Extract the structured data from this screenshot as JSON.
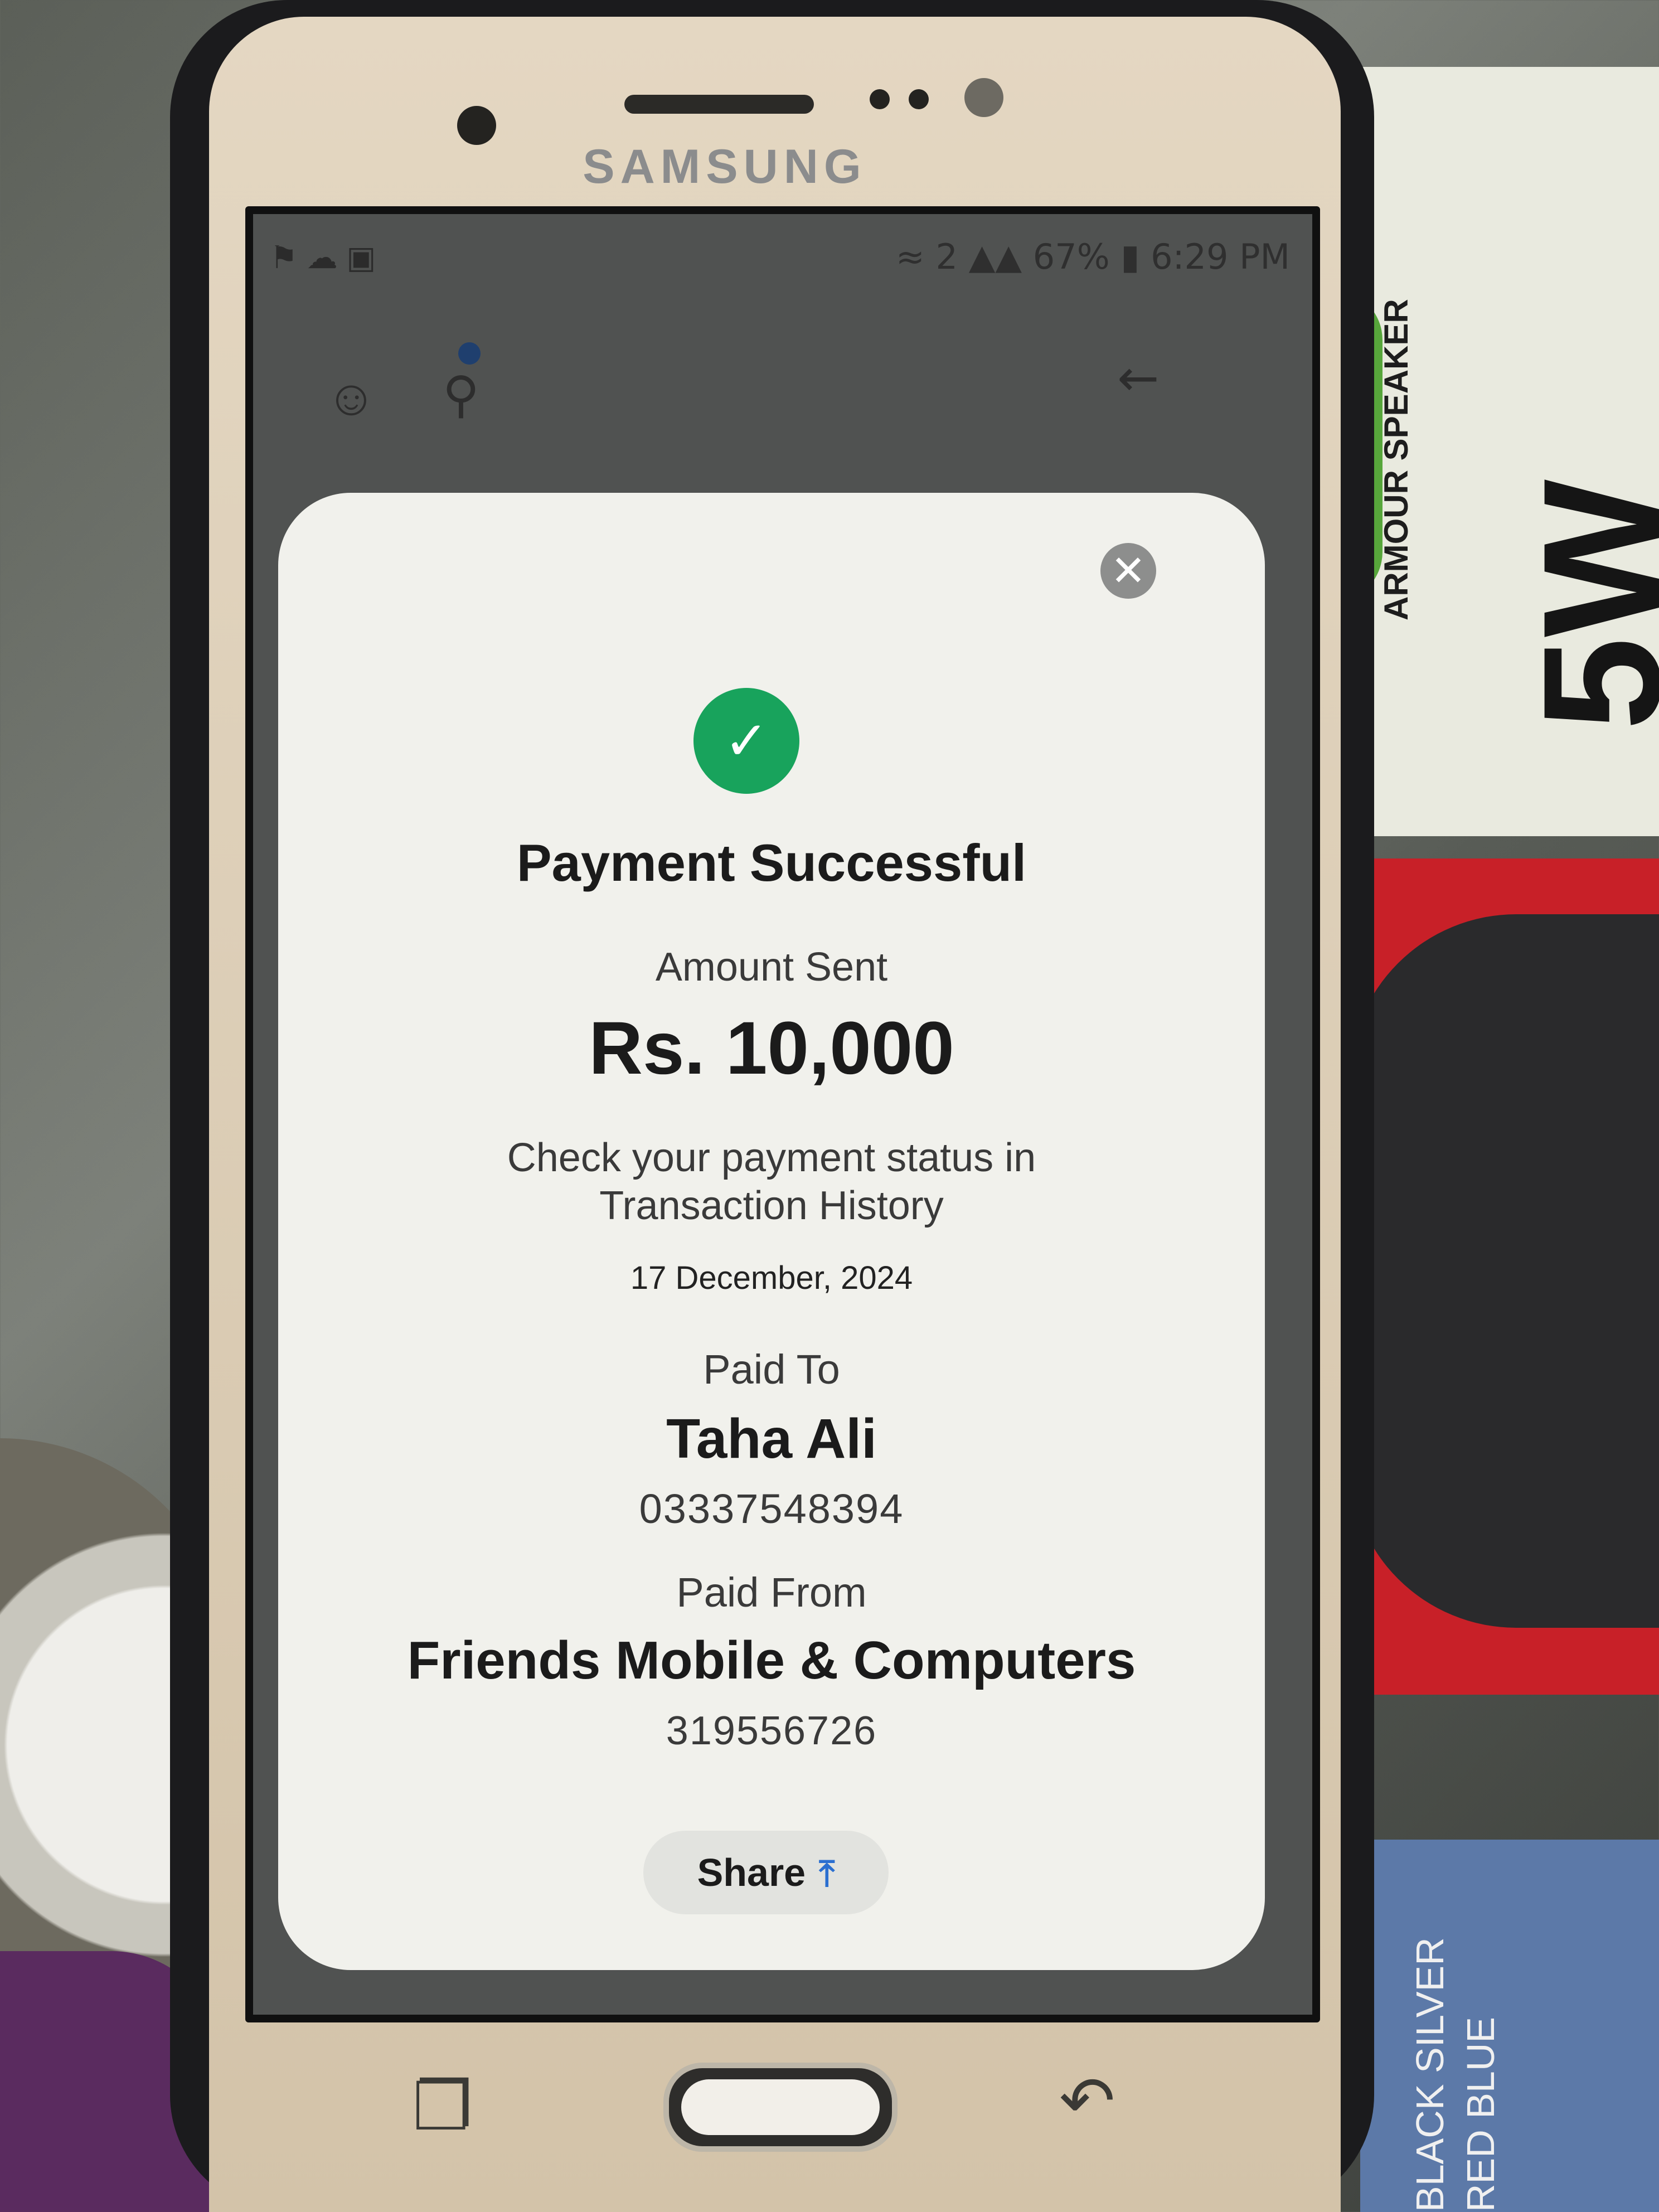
{
  "background": {
    "box_text": "ARMOUR SPEAKER",
    "box_big": "5W",
    "label_text": "BLACK SILVER RED BLUE"
  },
  "device": {
    "brand": "SAMSUNG"
  },
  "status_bar": {
    "battery": "67%",
    "time": "6:29 PM",
    "sim_badge": "2"
  },
  "modal": {
    "title": "Payment Successful",
    "amount_label": "Amount Sent",
    "amount": "Rs. 10,000",
    "status_message": "Check your payment status in Transaction History",
    "date": "17 December, 2024",
    "paid_to": {
      "label": "Paid To",
      "name": "Taha Ali",
      "number": "03337548394"
    },
    "paid_from": {
      "label": "Paid From",
      "name": "Friends Mobile & Computers",
      "number": "319556726"
    },
    "share_label": "Share"
  },
  "icons": {
    "close": "close-icon",
    "check": "checkmark-icon",
    "share": "share-upload-icon",
    "profile": "user-icon",
    "search": "search-icon",
    "back": "back-arrow-icon"
  },
  "colors": {
    "success_green": "#18a35c",
    "share_blue": "#2b6fd0",
    "modal_bg": "#f1f1ec"
  }
}
